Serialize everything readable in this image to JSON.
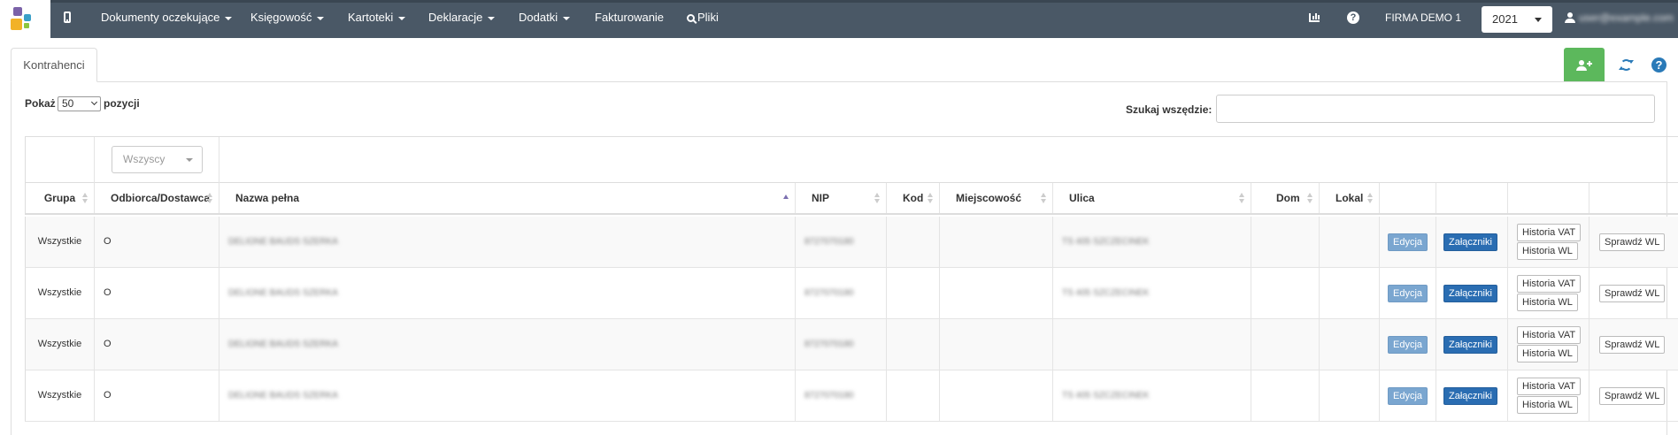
{
  "navbar": {
    "items": [
      {
        "label": "Dokumenty oczekujące",
        "dropdown": true
      },
      {
        "label": "Księgowość",
        "dropdown": true
      },
      {
        "label": "Kartoteki",
        "dropdown": true
      },
      {
        "label": "Deklaracje",
        "dropdown": true
      },
      {
        "label": "Dodatki",
        "dropdown": true
      },
      {
        "label": "Fakturowanie",
        "dropdown": false
      }
    ],
    "search_label": "Pliki",
    "company": "FIRMA DEMO 1",
    "year": "2021",
    "user_email": "user@example.com",
    "help_glyph": "?",
    "icons": [
      "mobile-icon",
      "search-icon",
      "bar-chart-icon",
      "help-icon",
      "user-icon"
    ]
  },
  "tabs": [
    {
      "label": "Kontrahenci",
      "active": true
    }
  ],
  "toolbar": {
    "help_glyph": "?",
    "accent_colors": {
      "add": "#5cb85c",
      "primary": "#2a7ab8",
      "navbar": "#4a5866"
    }
  },
  "table_controls": {
    "show_label": "Pokaż",
    "page_size": "50",
    "entries_label": "pozycji",
    "search_label": "Szukaj wszędzie:",
    "filter_value": "Wszyscy"
  },
  "table": {
    "columns": [
      "Grupa",
      "Odbiorca/Dostawca",
      "Nazwa pełna",
      "NIP",
      "Kod",
      "Miejscowość",
      "Ulica",
      "Dom",
      "Lokal",
      "",
      "",
      "",
      ""
    ],
    "rows": [
      {
        "grupa": "Wszystkie",
        "typ": "O",
        "nazwa": "DELIONE BAUDS SZERKA",
        "nip": "8727070180",
        "kod": "",
        "miejscowosc": "",
        "ulica": "TS 405 SZCZECINEK",
        "dom": "",
        "lokal": ""
      },
      {
        "grupa": "Wszystkie",
        "typ": "O",
        "nazwa": "DELIONE BAUDS SZERKA",
        "nip": "8727070180",
        "kod": "",
        "miejscowosc": "",
        "ulica": "TS 405 SZCZECINEK",
        "dom": "",
        "lokal": ""
      },
      {
        "grupa": "Wszystkie",
        "typ": "O",
        "nazwa": "DELIONE BAUDS SZERKA",
        "nip": "8727070180",
        "kod": "",
        "miejscowosc": "",
        "ulica": "",
        "dom": "",
        "lokal": ""
      },
      {
        "grupa": "Wszystkie",
        "typ": "O",
        "nazwa": "DELIONE BAUDS SZERKA",
        "nip": "8727070180",
        "kod": "",
        "miejscowosc": "",
        "ulica": "TS 405 SZCZECINEK",
        "dom": "",
        "lokal": ""
      }
    ],
    "actions": {
      "edit": "Edycja",
      "attachments": "Załączniki",
      "vat_history": "Historia VAT",
      "wl_history": "Historia WL",
      "check_wl": "Sprawdź WL"
    }
  }
}
